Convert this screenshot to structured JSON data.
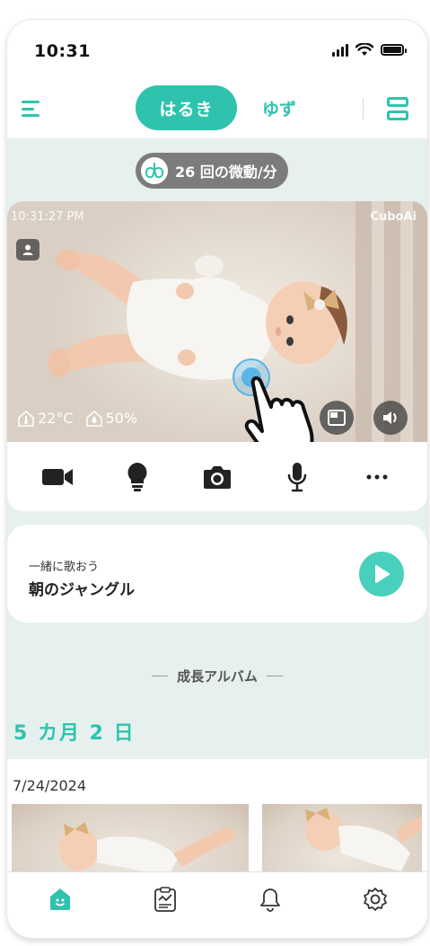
{
  "status_bar": {
    "time": "10:31"
  },
  "header": {
    "active_tab": "はるき",
    "other_tab": "ゆず"
  },
  "breathing": {
    "text": "26 回の微動/分"
  },
  "camera": {
    "timestamp": "10:31:27 PM",
    "brand": "CuboAi",
    "temperature": "22°C",
    "humidity": "50%",
    "controls": [
      "video-camera-icon",
      "lightbulb-icon",
      "camera-icon",
      "microphone-icon",
      "more-icon"
    ]
  },
  "music": {
    "subtitle": "一緒に歌おう",
    "title": "朝のジャングル"
  },
  "album": {
    "section_title": "成長アルバム",
    "age": "5 カ月 2 日",
    "date": "7/24/2024"
  },
  "bottom_nav": {
    "items": [
      "home-icon",
      "report-icon",
      "bell-icon",
      "settings-icon"
    ],
    "active": "home-icon"
  },
  "colors": {
    "accent": "#2fc3ad",
    "background": "#e6f1ef",
    "pill": "#7c7c7c"
  }
}
